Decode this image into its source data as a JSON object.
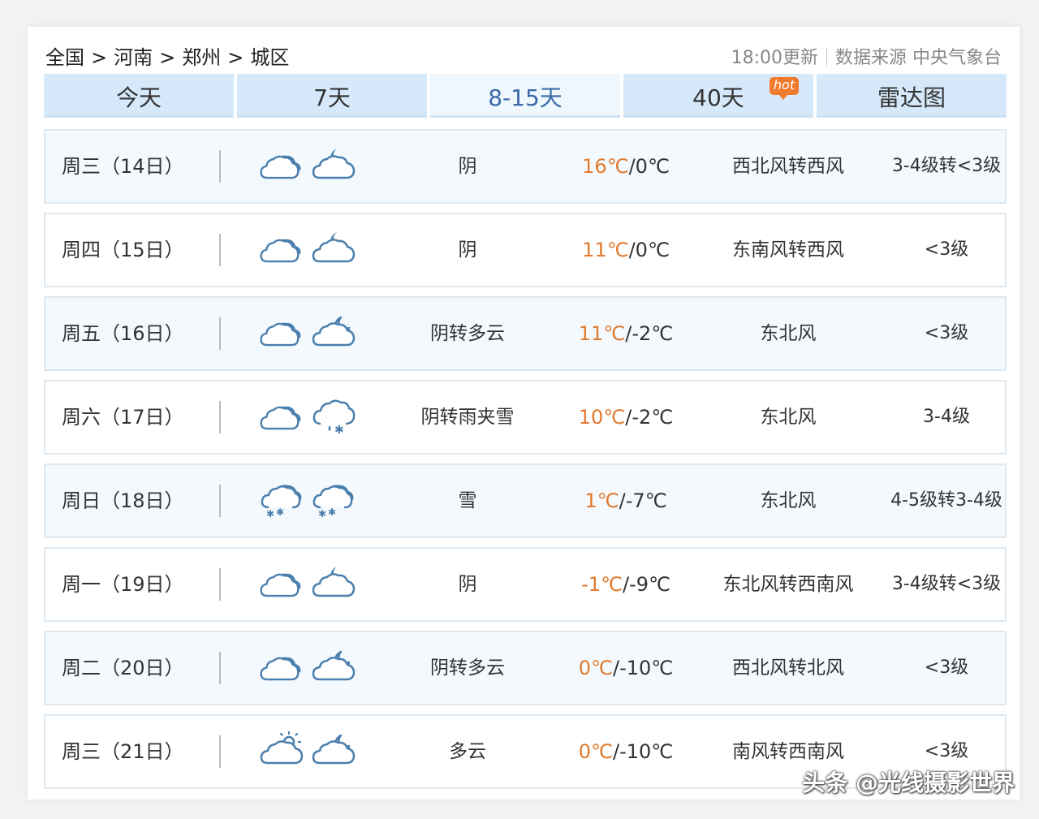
{
  "breadcrumb": [
    "全国",
    "河南",
    "郑州",
    "城区"
  ],
  "breadcrumb_sep": ">",
  "update_time": "18:00更新",
  "data_source": "数据来源 中央气象台",
  "tabs": [
    {
      "label": "今天",
      "active": false
    },
    {
      "label": "7天",
      "active": false
    },
    {
      "label": "8-15天",
      "active": true
    },
    {
      "label": "40天",
      "active": false,
      "badge": "hot"
    },
    {
      "label": "雷达图",
      "active": false
    }
  ],
  "forecast": [
    {
      "date": "周三（14日）",
      "icon_day": "cloudy-icon",
      "icon_night": "cloudy-moon-icon",
      "condition": "阴",
      "high": "16℃",
      "low": "0℃",
      "wind": "西北风转西风",
      "level": "3-4级转<3级"
    },
    {
      "date": "周四（15日）",
      "icon_day": "cloudy-icon",
      "icon_night": "cloudy-moon-icon",
      "condition": "阴",
      "high": "11℃",
      "low": "0℃",
      "wind": "东南风转西风",
      "level": "<3级"
    },
    {
      "date": "周五（16日）",
      "icon_day": "cloudy-icon",
      "icon_night": "partly-cloudy-night-icon",
      "condition": "阴转多云",
      "high": "11℃",
      "low": "-2℃",
      "wind": "东北风",
      "level": "<3级"
    },
    {
      "date": "周六（17日）",
      "icon_day": "cloudy-icon",
      "icon_night": "sleet-icon",
      "condition": "阴转雨夹雪",
      "high": "10℃",
      "low": "-2℃",
      "wind": "东北风",
      "level": "3-4级"
    },
    {
      "date": "周日（18日）",
      "icon_day": "snow-icon",
      "icon_night": "snow-icon",
      "condition": "雪",
      "high": "1℃",
      "low": "-7℃",
      "wind": "东北风",
      "level": "4-5级转3-4级"
    },
    {
      "date": "周一（19日）",
      "icon_day": "cloudy-icon",
      "icon_night": "cloudy-moon-icon",
      "condition": "阴",
      "high": "-1℃",
      "low": "-9℃",
      "wind": "东北风转西南风",
      "level": "3-4级转<3级"
    },
    {
      "date": "周二（20日）",
      "icon_day": "cloudy-icon",
      "icon_night": "partly-cloudy-night-icon",
      "condition": "阴转多云",
      "high": "0℃",
      "low": "-10℃",
      "wind": "西北风转北风",
      "level": "<3级"
    },
    {
      "date": "周三（21日）",
      "icon_day": "partly-sunny-icon",
      "icon_night": "partly-cloudy-night-icon",
      "condition": "多云",
      "high": "0℃",
      "low": "-10℃",
      "wind": "南风转西南风",
      "level": "<3级"
    }
  ],
  "colors": {
    "high_temp": "#e07a2e",
    "tab_active_text": "#3b6aa8",
    "tab_bg": "#d5e9fa",
    "hot_badge": "#f27a2d"
  },
  "watermark": "头条 @光线摄影世界"
}
